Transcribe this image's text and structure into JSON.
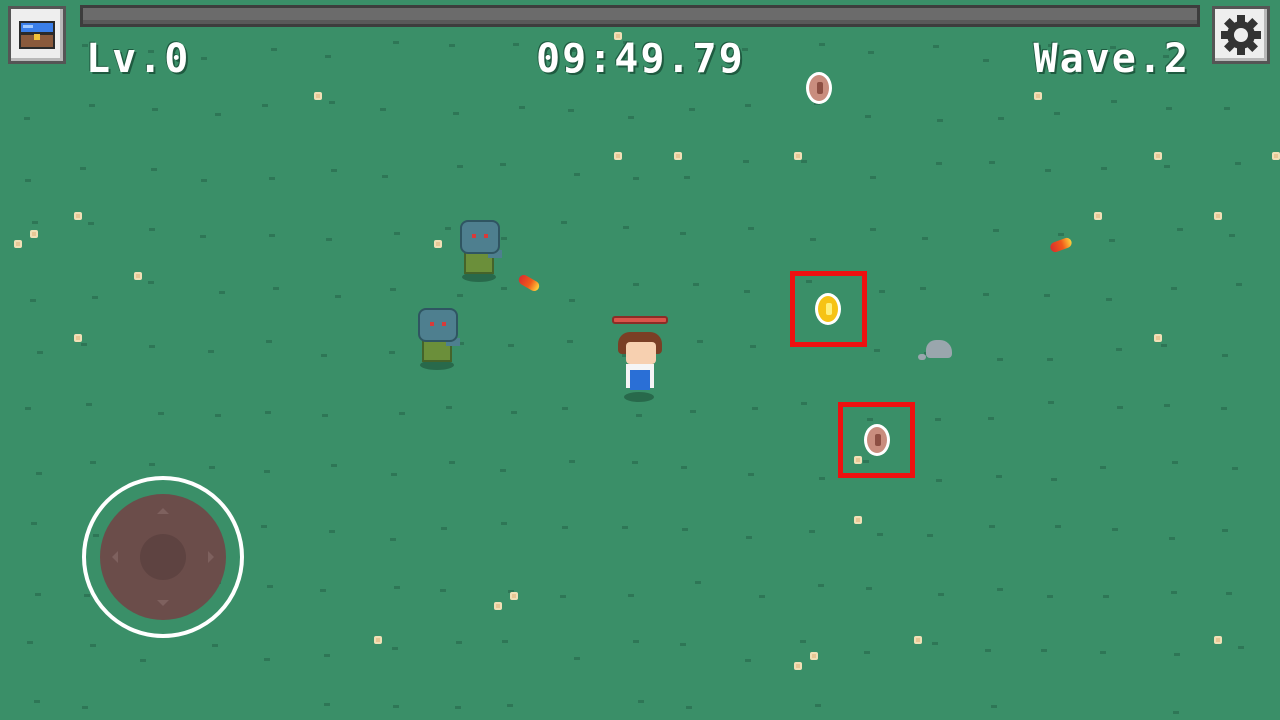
{
  "hud": {
    "level": "Lv.0",
    "timer": "09:49.79",
    "wave": "Wave.2",
    "xp_progress": 0
  },
  "buttons": {
    "inventory_icon": "treasure-chest-icon",
    "settings_icon": "gear-icon"
  },
  "colors": {
    "grass": "#3a8f68",
    "highlight": "#ee1010",
    "gold_coin": "#f6c315",
    "copper_coin": "#c98d7e"
  },
  "entities": {
    "coins": [
      "copper",
      "gold",
      "copper"
    ],
    "zombie_count": 2,
    "bullet_count": 2
  }
}
